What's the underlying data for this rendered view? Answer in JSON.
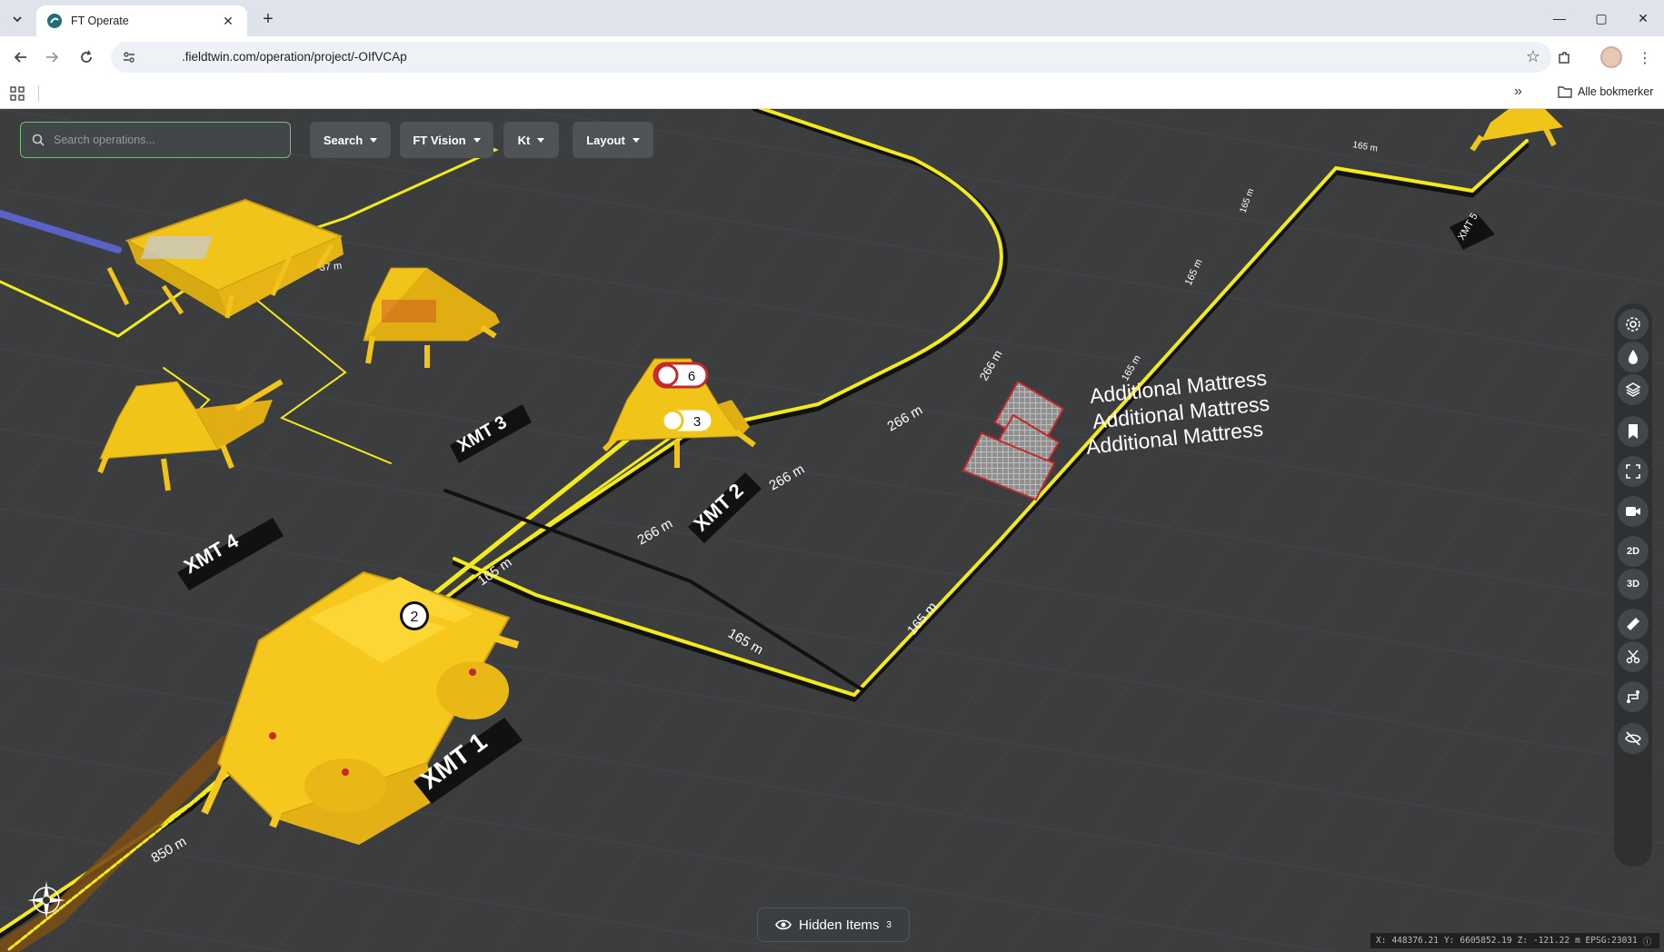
{
  "browser": {
    "tab_title": "FT Operate",
    "url": ".fieldtwin.com/operation/project/-OIfVCAp",
    "bookmarks_folder": "Alle bokmerker",
    "bookmarks_more": "»"
  },
  "toolbar": {
    "search_placeholder": "Search operations...",
    "buttons": [
      {
        "label": "Search"
      },
      {
        "label": "FT Vision"
      },
      {
        "label": "Kt"
      },
      {
        "label": "Layout"
      }
    ]
  },
  "scene": {
    "asset_labels": [
      "XMT 1",
      "XMT 2",
      "XMT 3",
      "XMT 4",
      "XMT 5"
    ],
    "mattress_labels": [
      "Additional Mattress",
      "Additional Mattress",
      "Additional Mattress"
    ],
    "markers": [
      {
        "number": "2"
      },
      {
        "number": "6"
      },
      {
        "number": "3"
      }
    ],
    "length_labels": [
      "850 m",
      "165 m",
      "165 m",
      "165 m",
      "165 m",
      "165 m",
      "165 m",
      "266 m",
      "266 m",
      "266 m",
      "266 m",
      "37 m",
      "165 m"
    ]
  },
  "side_tools": [
    {
      "icon": "settings-icon",
      "label": ""
    },
    {
      "icon": "water-drop-icon",
      "label": ""
    },
    {
      "icon": "layers-icon",
      "label": ""
    },
    {
      "icon": "bookmark-icon",
      "label": ""
    },
    {
      "icon": "fullscreen-icon",
      "label": ""
    },
    {
      "icon": "video-camera-icon",
      "label": ""
    },
    {
      "icon": "view-2d-icon",
      "label": "2D"
    },
    {
      "icon": "view-3d-icon",
      "label": "3D"
    },
    {
      "icon": "ruler-icon",
      "label": ""
    },
    {
      "icon": "scissors-icon",
      "label": ""
    },
    {
      "icon": "route-icon",
      "label": ""
    },
    {
      "icon": "eye-off-icon",
      "label": ""
    }
  ],
  "hidden_items": {
    "label": "Hidden Items",
    "count": "3"
  },
  "coordinates": {
    "x_label": "X:",
    "x": "448376.21",
    "y_label": "Y:",
    "y": "6605852.19",
    "z_label": "Z:",
    "z": "-121.22",
    "unit_crs": "m EPSG:23031"
  }
}
